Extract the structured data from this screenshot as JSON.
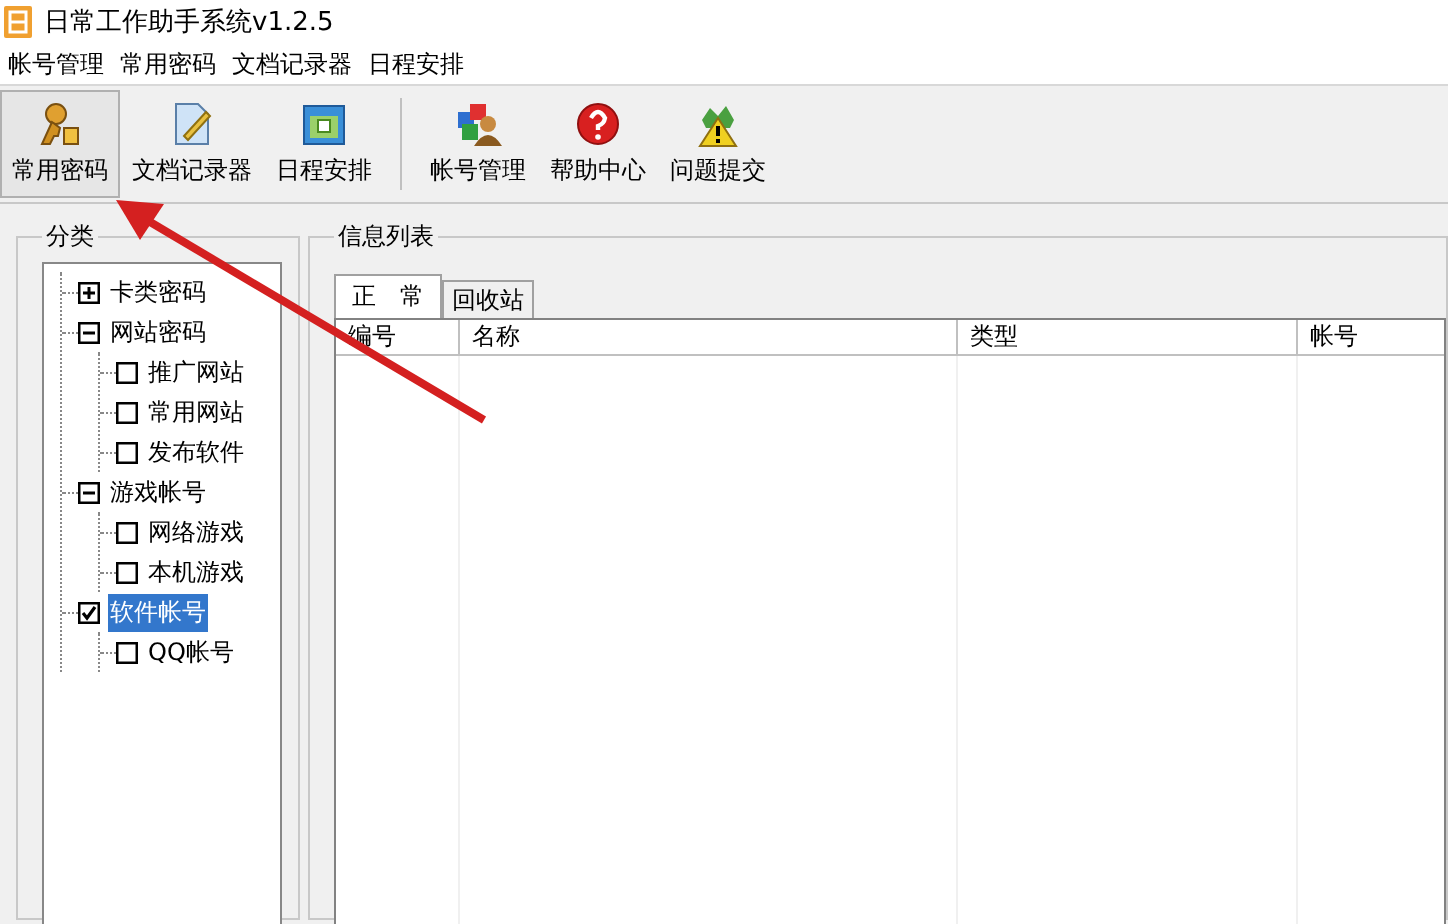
{
  "window": {
    "title": "日常工作助手系统v1.2.5"
  },
  "menu": [
    "帐号管理",
    "常用密码",
    "文档记录器",
    "日程安排"
  ],
  "toolbar": [
    {
      "label": "常用密码",
      "kind": "key",
      "selected": true,
      "separator_after": false
    },
    {
      "label": "文档记录器",
      "kind": "doc",
      "selected": false,
      "separator_after": false
    },
    {
      "label": "日程安排",
      "kind": "calendar",
      "selected": false,
      "separator_after": true
    },
    {
      "label": "帐号管理",
      "kind": "people",
      "selected": false,
      "separator_after": false
    },
    {
      "label": "帮助中心",
      "kind": "help",
      "selected": false,
      "separator_after": false
    },
    {
      "label": "问题提交",
      "kind": "submit",
      "selected": false,
      "separator_after": false
    }
  ],
  "category": {
    "title": "分类",
    "tree": [
      {
        "label": "卡类密码",
        "kind": "expander",
        "expanded": false,
        "selected": false
      },
      {
        "label": "网站密码",
        "kind": "expander",
        "expanded": true,
        "selected": false,
        "children": [
          {
            "label": "推广网站",
            "kind": "checkbox",
            "checked": false,
            "selected": false
          },
          {
            "label": "常用网站",
            "kind": "checkbox",
            "checked": false,
            "selected": false
          },
          {
            "label": "发布软件",
            "kind": "checkbox",
            "checked": false,
            "selected": false
          }
        ]
      },
      {
        "label": "游戏帐号",
        "kind": "expander",
        "expanded": true,
        "selected": false,
        "children": [
          {
            "label": "网络游戏",
            "kind": "checkbox",
            "checked": false,
            "selected": false
          },
          {
            "label": "本机游戏",
            "kind": "checkbox",
            "checked": false,
            "selected": false
          }
        ]
      },
      {
        "label": "软件帐号",
        "kind": "checkbox",
        "checked": true,
        "selected": true,
        "children": [
          {
            "label": "QQ帐号",
            "kind": "checkbox",
            "checked": false,
            "selected": false
          }
        ]
      }
    ]
  },
  "info": {
    "title": "信息列表",
    "tabs": [
      {
        "label": "正　常",
        "selected": true
      },
      {
        "label": "回收站",
        "selected": false
      }
    ],
    "table": {
      "columns": [
        "编号",
        "名称",
        "类型",
        "帐号"
      ]
    }
  },
  "annotation": {
    "kind": "arrow"
  }
}
